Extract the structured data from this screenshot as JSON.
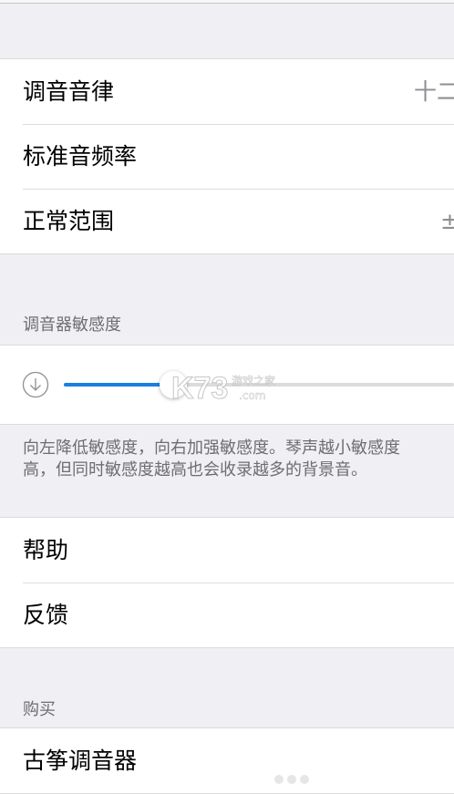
{
  "settings_group": {
    "rows": [
      {
        "label": "调音音律",
        "value": "十二"
      },
      {
        "label": "标准音频率",
        "value": ""
      },
      {
        "label": "正常范围",
        "value": "±"
      }
    ]
  },
  "sensitivity": {
    "header": "调音器敏感度",
    "level": 0.28,
    "footer_line1": "向左降低敏感度，向右加强敏感度。琴声越小敏感度",
    "footer_line2": "高，但同时敏感度越高也会收录越多的背景音。"
  },
  "support_group": {
    "rows": [
      {
        "label": "帮助"
      },
      {
        "label": "反馈"
      }
    ]
  },
  "purchase": {
    "header": "购买",
    "rows": [
      {
        "label": "古筝调音器"
      }
    ]
  },
  "watermark": {
    "brand": "K73",
    "tagline": "游戏之家",
    "domain": ".com"
  },
  "colors": {
    "accent": "#1a7fe0",
    "secondary_text": "#6d6d72",
    "separator": "#dcdcdc"
  }
}
